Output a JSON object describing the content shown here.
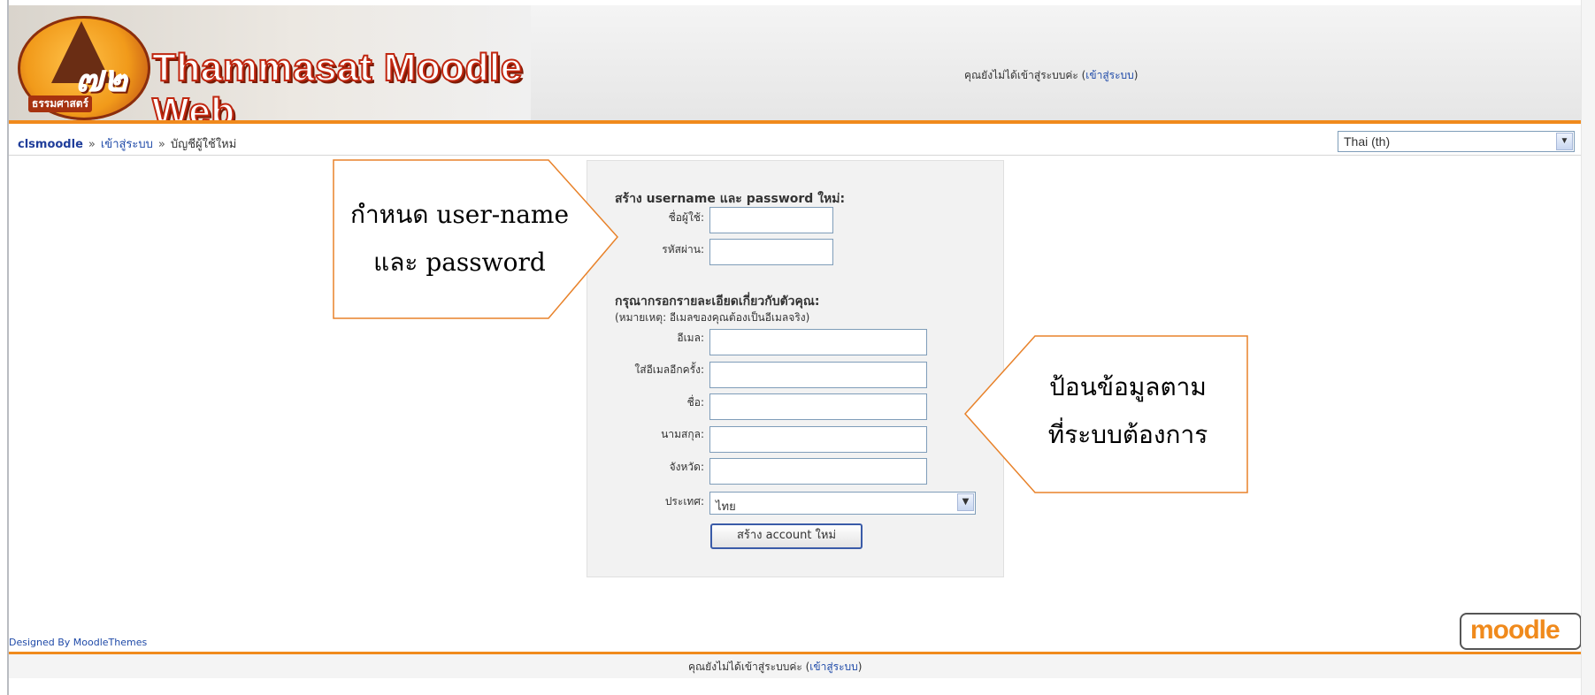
{
  "header": {
    "logo_numeral": "๗๒",
    "logo_subtext": "ธรรมศาสตร์",
    "site_title": "Thammasat Moodle Web",
    "login_status_prefix": "คุณยังไม่ได้เข้าสู่ระบบค่ะ (",
    "login_link": "เข้าสู่ระบบ",
    "login_status_suffix": ")"
  },
  "breadcrumb": {
    "home": "clsmoodle",
    "separator": "»",
    "items": [
      "เข้าสู่ระบบ",
      "บัญชีผู้ใช้ใหม่"
    ]
  },
  "language_select": {
    "value": "Thai (th)"
  },
  "form": {
    "account_section_title": "สร้าง username และ password ใหม่:",
    "username_label": "ชื่อผู้ใช้:",
    "password_label": "รหัสผ่าน:",
    "details_section_title": "กรุณากรอกรายละเอียดเกี่ยวกับตัวคุณ:",
    "details_note": "(หมายเหตุ: อีเมลของคุณต้องเป็นอีเมลจริง)",
    "email_label": "อีเมล:",
    "email_again_label": "ใส่อีเมลอีกครั้ง:",
    "firstname_label": "ชื่อ:",
    "lastname_label": "นามสกุล:",
    "city_label": "จังหวัด:",
    "country_label": "ประเทศ:",
    "country_value": "ไทย",
    "submit_label": "สร้าง account ใหม่"
  },
  "callouts": {
    "left_line1": "กำหนด user-name",
    "left_line2": "และ password",
    "right_line1": "ป้อนข้อมูลตาม",
    "right_line2": "ที่ระบบต้องการ"
  },
  "footer": {
    "designed_by": "Designed By MoodleThemes",
    "moodle_logo": "moodle",
    "login_status_prefix": "คุณยังไม่ได้เข้าสู่ระบบค่ะ (",
    "login_link": "เข้าสู่ระบบ",
    "login_status_suffix": ")"
  },
  "colors": {
    "accent_orange": "#f08a1c",
    "link_blue": "#1f4aa8",
    "callout_border": "#e8822a"
  }
}
